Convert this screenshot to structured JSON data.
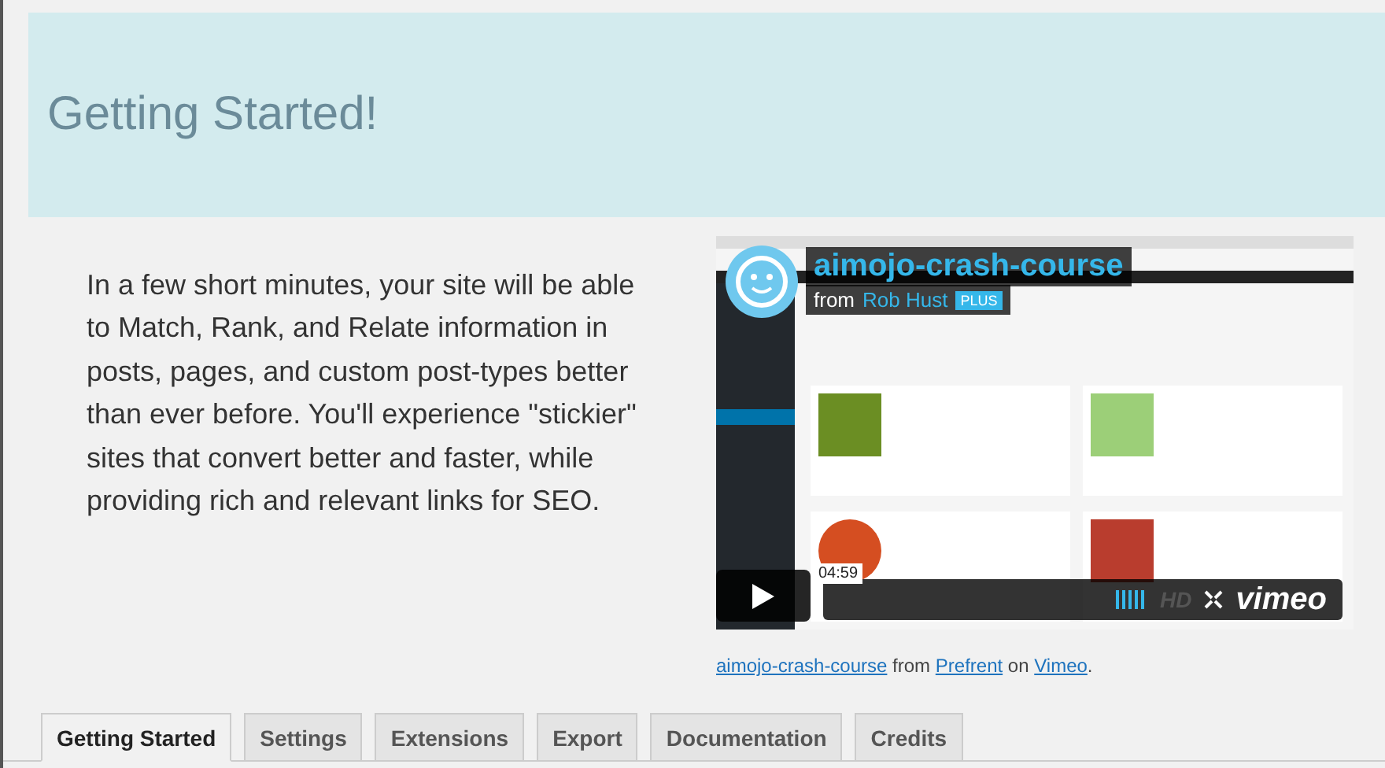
{
  "banner": {
    "title": "Getting Started!"
  },
  "intro": "In a few short minutes, your site will be able to Match, Rank, and Relate information in posts, pages, and custom post-types better than ever before. You'll experience \"stickier\" sites that convert better and faster, while providing rich and relevant links for SEO.",
  "video": {
    "kind": "picture",
    "title": "aimojo-crash-course",
    "from": "from",
    "author": "Rob Hust",
    "badge": "PLUS",
    "duration": "04:59",
    "hd": "HD",
    "brand": "vimeo"
  },
  "caption": [
    {
      "kind": "link",
      "text": "aimojo-crash-course"
    },
    {
      "kind": "text",
      "text": "from"
    },
    {
      "kind": "link",
      "text": "Prefrent"
    },
    {
      "kind": "text",
      "text": "on"
    },
    {
      "kind": "link",
      "text": "Vimeo"
    },
    {
      "kind": "text",
      "text": "."
    }
  ],
  "tabs": [
    {
      "label": "Getting Started",
      "selected": true
    },
    {
      "label": "Settings",
      "selected": false
    },
    {
      "label": "Extensions",
      "selected": false
    },
    {
      "label": "Export",
      "selected": false
    },
    {
      "label": "Documentation",
      "selected": false
    },
    {
      "label": "Credits",
      "selected": false
    }
  ]
}
